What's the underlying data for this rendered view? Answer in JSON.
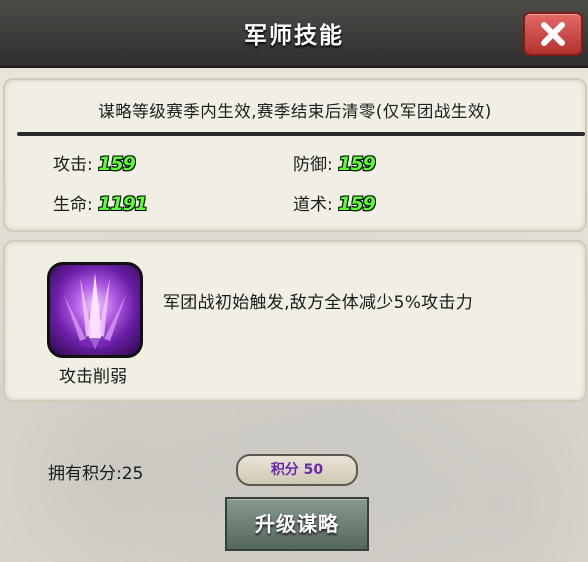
{
  "window": {
    "title": "军师技能",
    "close_icon": "close-icon"
  },
  "info_panel": {
    "notice": "谋略等级赛季内生效,赛季结束后清零(仅军团战生效)",
    "stats": [
      {
        "label": "攻击:",
        "value": "159"
      },
      {
        "label": "防御:",
        "value": "159"
      },
      {
        "label": "生命:",
        "value": "1191"
      },
      {
        "label": "道术:",
        "value": "159"
      }
    ]
  },
  "skill_panel": {
    "icon": "claw-strike-icon",
    "name": "攻击削弱",
    "description": "军团战初始触发,敌方全体减少5%攻击力"
  },
  "footer": {
    "points_text": "拥有积分:25",
    "cost_text": "积分 50",
    "upgrade_label": "升级谋略"
  },
  "colors": {
    "stat_value": "#58ff32",
    "cost_text": "#6a2aa8",
    "close_button": "#c9413c",
    "upgrade_button": "#6b7d72"
  }
}
